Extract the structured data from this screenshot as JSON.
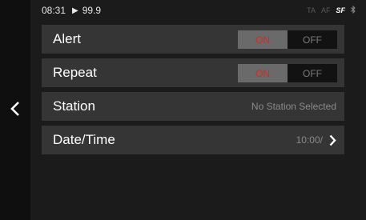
{
  "status_bar": {
    "time": "08:31",
    "play_icon": "play-icon",
    "frequency": "99.9",
    "indicators": [
      {
        "label": "TA",
        "active": false
      },
      {
        "label": "AF",
        "active": false
      },
      {
        "label": "SF",
        "active": true
      }
    ],
    "bluetooth_icon": "bluetooth-icon"
  },
  "nav": {
    "back_icon": "chevron-left-icon"
  },
  "settings": {
    "alert": {
      "label": "Alert",
      "on_label": "ON",
      "off_label": "OFF",
      "selected": "ON"
    },
    "repeat": {
      "label": "Repeat",
      "on_label": "ON",
      "off_label": "OFF",
      "selected": "ON"
    },
    "station": {
      "label": "Station",
      "value": "No Station Selected"
    },
    "datetime": {
      "label": "Date/Time",
      "value": "10:00/",
      "icon": "chevron-right-icon"
    }
  },
  "colors": {
    "on_text": "#e1251b",
    "row_background": "#353535",
    "toggle_selected_bg": "#6a6a6a"
  }
}
